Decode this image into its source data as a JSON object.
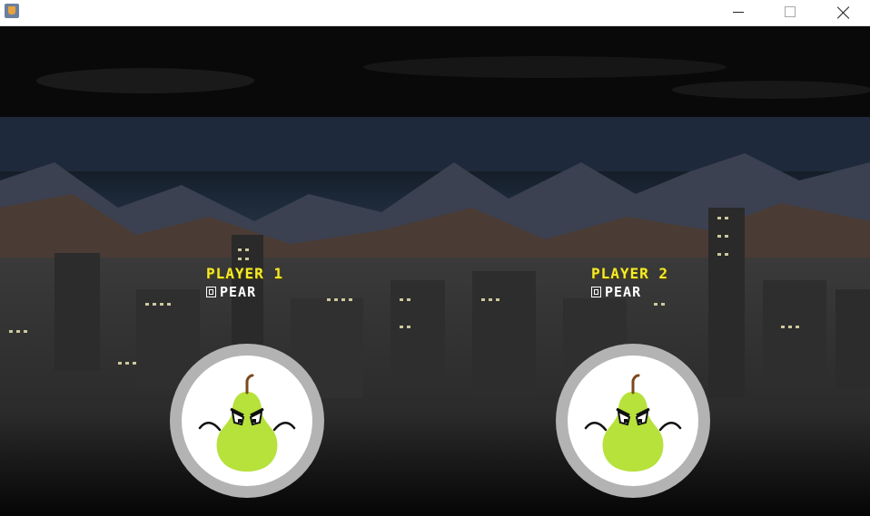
{
  "window": {
    "title": "",
    "controls": [
      "minimize-icon",
      "maximize-icon",
      "close-icon"
    ]
  },
  "players": [
    {
      "label": "PLAYER 1",
      "character": "PEAR"
    },
    {
      "label": "PLAYER 2",
      "character": "PEAR"
    }
  ],
  "colors": {
    "player_label": "#f4ec2a",
    "character_text": "#ffffff",
    "avatar_ring": "#b3b3b3",
    "pear_green": "#a8d92b"
  }
}
